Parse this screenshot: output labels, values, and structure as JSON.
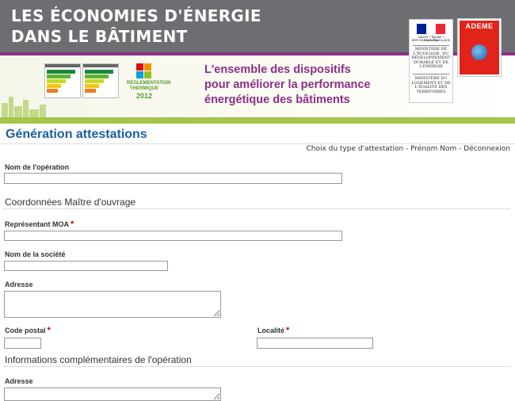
{
  "header": {
    "title_line1": "LES ÉCONOMIES D'ÉNERGIE",
    "title_line2": "DANS LE BÂTIMENT",
    "tagline_line1": "L'ensemble des dispositifs",
    "tagline_line2": "pour améliorer la performance",
    "tagline_line3": "énergétique des bâtiments",
    "rt_logo": {
      "line1": "RÉGLEMENTATION",
      "line2": "THERMIQUE",
      "year": "2012"
    },
    "ministry": {
      "republique": "Liberté • Égalité • Fraternité",
      "republique2": "RÉPUBLIQUE FRANÇAISE",
      "block1": "MINISTÈRE DE L'ÉCOLOGIE, DU DÉVELOPPEMENT DURABLE ET DE L'ÉNERGIE",
      "block2": "MINISTÈRE DU LOGEMENT ET DE L'ÉGALITÉ DES TERRITOIRES"
    },
    "ademe": "ADEME"
  },
  "page": {
    "title": "Génération attestations",
    "links": "Choix du type d'attestation - Prénom Nom - Déconnexion"
  },
  "form": {
    "operation_name_label": "Nom de l'opération",
    "operation_name_value": "",
    "section_moa": "Coordonnées Maître d'ouvrage",
    "moa_rep_label": "Représentant MOA",
    "moa_rep_value": "",
    "company_label": "Nom de la société",
    "company_value": "",
    "address_label": "Adresse",
    "address_value": "",
    "postcode_label": "Code postal",
    "postcode_value": "",
    "city_label": "Localité",
    "city_value": "",
    "section_info": "Informations complémentaires de l'opération",
    "address2_label": "Adresse",
    "address2_value": "",
    "required_mark": "*"
  },
  "colors": {
    "banner_grey": "#6d6e71",
    "purple": "#8b2f87",
    "green": "#a6c44a",
    "title_blue": "#1a5fa0",
    "required_red": "#cc0000"
  }
}
